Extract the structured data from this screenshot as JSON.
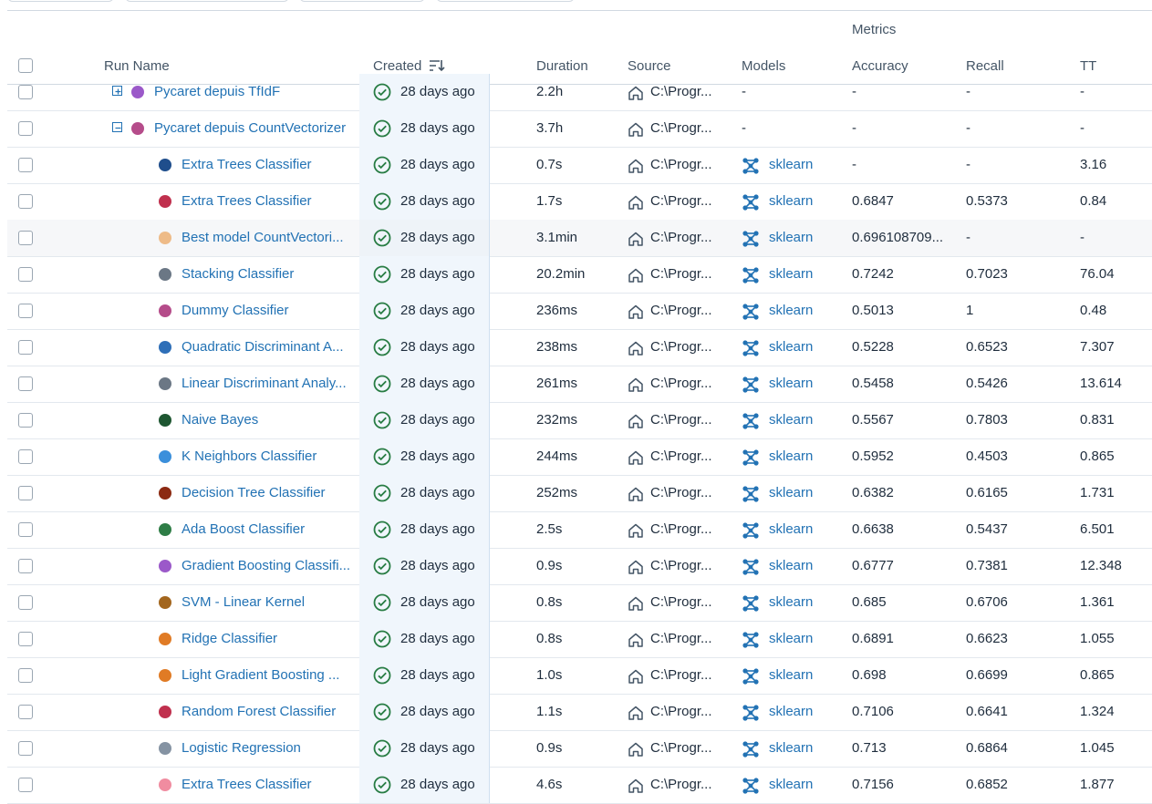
{
  "header": {
    "group_label": "Metrics",
    "columns": {
      "run_name": "Run Name",
      "created": "Created",
      "duration": "Duration",
      "source": "Source",
      "models": "Models",
      "accuracy": "Accuracy",
      "recall": "Recall",
      "tt": "TT"
    }
  },
  "rows": [
    {
      "expander": "plus",
      "color": "#9b59c9",
      "name": "Pycaret depuis TfIdF",
      "created": "28 days ago",
      "duration": "2.2h",
      "source": "C:\\Progr...",
      "model": "-",
      "accuracy": "-",
      "recall": "-",
      "tt": "-"
    },
    {
      "expander": "minus",
      "color": "#b54c8a",
      "name": "Pycaret depuis CountVectorizer",
      "created": "28 days ago",
      "duration": "3.7h",
      "source": "C:\\Progr...",
      "model": "-",
      "accuracy": "-",
      "recall": "-",
      "tt": "-"
    },
    {
      "color": "#1f4e8c",
      "name": "Extra Trees Classifier",
      "created": "28 days ago",
      "duration": "0.7s",
      "source": "C:\\Progr...",
      "model": "sklearn",
      "accuracy": "-",
      "recall": "-",
      "tt": "3.16"
    },
    {
      "color": "#c0304e",
      "name": "Extra Trees Classifier",
      "created": "28 days ago",
      "duration": "1.7s",
      "source": "C:\\Progr...",
      "model": "sklearn",
      "accuracy": "0.6847",
      "recall": "0.5373",
      "tt": "0.84"
    },
    {
      "color": "#eebb88",
      "name": "Best model CountVectori...",
      "created": "28 days ago",
      "duration": "3.1min",
      "source": "C:\\Progr...",
      "model": "sklearn",
      "accuracy": "0.696108709...",
      "recall": "-",
      "tt": "-",
      "highlight": true
    },
    {
      "color": "#6b7785",
      "name": "Stacking Classifier",
      "created": "28 days ago",
      "duration": "20.2min",
      "source": "C:\\Progr...",
      "model": "sklearn",
      "accuracy": "0.7242",
      "recall": "0.7023",
      "tt": "76.04"
    },
    {
      "color": "#b54c8a",
      "name": "Dummy Classifier",
      "created": "28 days ago",
      "duration": "236ms",
      "source": "C:\\Progr...",
      "model": "sklearn",
      "accuracy": "0.5013",
      "recall": "1",
      "tt": "0.48"
    },
    {
      "color": "#2e6fb8",
      "name": "Quadratic Discriminant A...",
      "created": "28 days ago",
      "duration": "238ms",
      "source": "C:\\Progr...",
      "model": "sklearn",
      "accuracy": "0.5228",
      "recall": "0.6523",
      "tt": "7.307"
    },
    {
      "color": "#6b7785",
      "name": "Linear Discriminant Analy...",
      "created": "28 days ago",
      "duration": "261ms",
      "source": "C:\\Progr...",
      "model": "sklearn",
      "accuracy": "0.5458",
      "recall": "0.5426",
      "tt": "13.614"
    },
    {
      "color": "#1e5631",
      "name": "Naive Bayes",
      "created": "28 days ago",
      "duration": "232ms",
      "source": "C:\\Progr...",
      "model": "sklearn",
      "accuracy": "0.5567",
      "recall": "0.7803",
      "tt": "0.831"
    },
    {
      "color": "#3b8fdb",
      "name": "K Neighbors Classifier",
      "created": "28 days ago",
      "duration": "244ms",
      "source": "C:\\Progr...",
      "model": "sklearn",
      "accuracy": "0.5952",
      "recall": "0.4503",
      "tt": "0.865"
    },
    {
      "color": "#8c2a12",
      "name": "Decision Tree Classifier",
      "created": "28 days ago",
      "duration": "252ms",
      "source": "C:\\Progr...",
      "model": "sklearn",
      "accuracy": "0.6382",
      "recall": "0.6165",
      "tt": "1.731"
    },
    {
      "color": "#2e7d46",
      "name": "Ada Boost Classifier",
      "created": "28 days ago",
      "duration": "2.5s",
      "source": "C:\\Progr...",
      "model": "sklearn",
      "accuracy": "0.6638",
      "recall": "0.5437",
      "tt": "6.501"
    },
    {
      "color": "#9b59c9",
      "name": "Gradient Boosting Classifi...",
      "created": "28 days ago",
      "duration": "0.9s",
      "source": "C:\\Progr...",
      "model": "sklearn",
      "accuracy": "0.6777",
      "recall": "0.7381",
      "tt": "12.348"
    },
    {
      "color": "#a3661e",
      "name": "SVM - Linear Kernel",
      "created": "28 days ago",
      "duration": "0.8s",
      "source": "C:\\Progr...",
      "model": "sklearn",
      "accuracy": "0.685",
      "recall": "0.6706",
      "tt": "1.361"
    },
    {
      "color": "#e07b25",
      "name": "Ridge Classifier",
      "created": "28 days ago",
      "duration": "0.8s",
      "source": "C:\\Progr...",
      "model": "sklearn",
      "accuracy": "0.6891",
      "recall": "0.6623",
      "tt": "1.055"
    },
    {
      "color": "#e07b25",
      "name": "Light Gradient Boosting ...",
      "created": "28 days ago",
      "duration": "1.0s",
      "source": "C:\\Progr...",
      "model": "sklearn",
      "accuracy": "0.698",
      "recall": "0.6699",
      "tt": "0.865"
    },
    {
      "color": "#c0304e",
      "name": "Random Forest Classifier",
      "created": "28 days ago",
      "duration": "1.1s",
      "source": "C:\\Progr...",
      "model": "sklearn",
      "accuracy": "0.7106",
      "recall": "0.6641",
      "tt": "1.324"
    },
    {
      "color": "#8593a3",
      "name": "Logistic Regression",
      "created": "28 days ago",
      "duration": "0.9s",
      "source": "C:\\Progr...",
      "model": "sklearn",
      "accuracy": "0.713",
      "recall": "0.6864",
      "tt": "1.045"
    },
    {
      "color": "#f08ca0",
      "name": "Extra Trees Classifier",
      "created": "28 days ago",
      "duration": "4.6s",
      "source": "C:\\Progr...",
      "model": "sklearn",
      "accuracy": "0.7156",
      "recall": "0.6852",
      "tt": "1.877"
    }
  ],
  "colors": {
    "link": "#2272b4",
    "success": "#277c43",
    "created_band": "#f0f6fc"
  },
  "icons": {
    "status": "check-circle-icon",
    "source": "home-icon",
    "model": "sklearn-model-icon",
    "sort": "sort-descending-icon"
  }
}
